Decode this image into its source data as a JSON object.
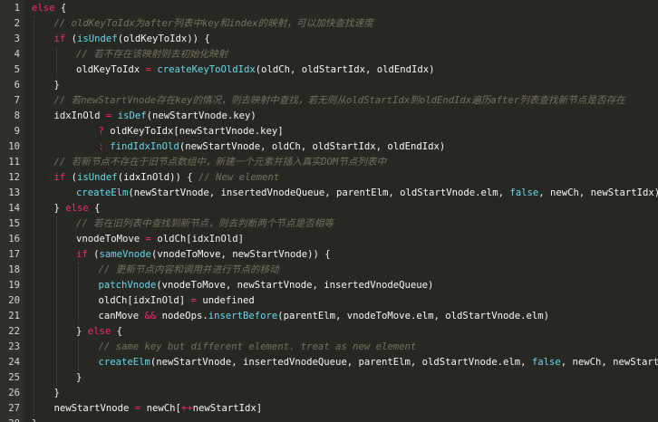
{
  "colors": {
    "background": "#272822",
    "gutter": "#2f302a",
    "plain": "#f8f8f2",
    "keyword": "#f92672",
    "function": "#66d9ef",
    "comment": "#75715e"
  },
  "lines": [
    {
      "n": "1",
      "indent": 0,
      "tokens": [
        {
          "t": "else",
          "c": "kw"
        },
        {
          "t": " {",
          "c": "pl"
        }
      ]
    },
    {
      "n": "2",
      "indent": 1,
      "tokens": [
        {
          "t": "// oldKeyToIdx为after列表中key和index的映射，可以加快查找速度",
          "c": "cm"
        }
      ]
    },
    {
      "n": "3",
      "indent": 1,
      "tokens": [
        {
          "t": "if",
          "c": "kw"
        },
        {
          "t": " (",
          "c": "pl"
        },
        {
          "t": "isUndef",
          "c": "fn"
        },
        {
          "t": "(oldKeyToIdx)) {",
          "c": "pl"
        }
      ]
    },
    {
      "n": "4",
      "indent": 2,
      "tokens": [
        {
          "t": "// 若不存在该映射则去初始化映射",
          "c": "cm"
        }
      ]
    },
    {
      "n": "5",
      "indent": 2,
      "tokens": [
        {
          "t": "oldKeyToIdx ",
          "c": "pl"
        },
        {
          "t": "=",
          "c": "kw"
        },
        {
          "t": " ",
          "c": "pl"
        },
        {
          "t": "createKeyToOldIdx",
          "c": "fn"
        },
        {
          "t": "(oldCh, oldStartIdx, oldEndIdx)",
          "c": "pl"
        }
      ]
    },
    {
      "n": "6",
      "indent": 1,
      "tokens": [
        {
          "t": "}",
          "c": "pl"
        }
      ]
    },
    {
      "n": "7",
      "indent": 1,
      "tokens": [
        {
          "t": "// 若newStartVnode存在key的情况，则去映射中查找，若无则从oldStartIdx到oldEndIdx遍历after列表查找新节点是否存在",
          "c": "cm"
        }
      ]
    },
    {
      "n": "8",
      "indent": 1,
      "tokens": [
        {
          "t": "idxInOld ",
          "c": "pl"
        },
        {
          "t": "=",
          "c": "kw"
        },
        {
          "t": " ",
          "c": "pl"
        },
        {
          "t": "isDef",
          "c": "fn"
        },
        {
          "t": "(newStartVnode.key)",
          "c": "pl"
        }
      ]
    },
    {
      "n": "9",
      "indent": 3,
      "tokens": [
        {
          "t": "?",
          "c": "kw"
        },
        {
          "t": " oldKeyToIdx[newStartVnode.key]",
          "c": "pl"
        }
      ]
    },
    {
      "n": "10",
      "indent": 3,
      "tokens": [
        {
          "t": ":",
          "c": "kw"
        },
        {
          "t": " ",
          "c": "pl"
        },
        {
          "t": "findIdxInOld",
          "c": "fn"
        },
        {
          "t": "(newStartVnode, oldCh, oldStartIdx, oldEndIdx)",
          "c": "pl"
        }
      ]
    },
    {
      "n": "11",
      "indent": 1,
      "tokens": [
        {
          "t": "// 若新节点不存在于旧节点数组中，新建一个元素并插入真实DOM节点列表中",
          "c": "cm"
        }
      ]
    },
    {
      "n": "12",
      "indent": 1,
      "tokens": [
        {
          "t": "if",
          "c": "kw"
        },
        {
          "t": " (",
          "c": "pl"
        },
        {
          "t": "isUndef",
          "c": "fn"
        },
        {
          "t": "(idxInOld)) { ",
          "c": "pl"
        },
        {
          "t": "// New element",
          "c": "cm"
        }
      ]
    },
    {
      "n": "13",
      "indent": 2,
      "tokens": [
        {
          "t": "createElm",
          "c": "fn"
        },
        {
          "t": "(newStartVnode, insertedVnodeQueue, parentElm, oldStartVnode.elm, ",
          "c": "pl"
        },
        {
          "t": "false",
          "c": "con"
        },
        {
          "t": ", newCh, newStartIdx)",
          "c": "pl"
        }
      ]
    },
    {
      "n": "14",
      "indent": 1,
      "tokens": [
        {
          "t": "} ",
          "c": "pl"
        },
        {
          "t": "else",
          "c": "kw"
        },
        {
          "t": " {",
          "c": "pl"
        }
      ]
    },
    {
      "n": "15",
      "indent": 2,
      "tokens": [
        {
          "t": "// 若在旧列表中查找到新节点，则去判断两个节点是否相等",
          "c": "cm"
        }
      ]
    },
    {
      "n": "16",
      "indent": 2,
      "tokens": [
        {
          "t": "vnodeToMove ",
          "c": "pl"
        },
        {
          "t": "=",
          "c": "kw"
        },
        {
          "t": " oldCh[idxInOld]",
          "c": "pl"
        }
      ]
    },
    {
      "n": "17",
      "indent": 2,
      "tokens": [
        {
          "t": "if",
          "c": "kw"
        },
        {
          "t": " (",
          "c": "pl"
        },
        {
          "t": "sameVnode",
          "c": "fn"
        },
        {
          "t": "(vnodeToMove, newStartVnode)) {",
          "c": "pl"
        }
      ]
    },
    {
      "n": "18",
      "indent": 3,
      "tokens": [
        {
          "t": "// 更新节点内容和调用并进行节点的移动",
          "c": "cm"
        }
      ]
    },
    {
      "n": "19",
      "indent": 3,
      "tokens": [
        {
          "t": "patchVnode",
          "c": "fn"
        },
        {
          "t": "(vnodeToMove, newStartVnode, insertedVnodeQueue)",
          "c": "pl"
        }
      ]
    },
    {
      "n": "20",
      "indent": 3,
      "tokens": [
        {
          "t": "oldCh[idxInOld] ",
          "c": "pl"
        },
        {
          "t": "=",
          "c": "kw"
        },
        {
          "t": " undefined",
          "c": "pl"
        }
      ]
    },
    {
      "n": "21",
      "indent": 3,
      "tokens": [
        {
          "t": "canMove ",
          "c": "pl"
        },
        {
          "t": "&&",
          "c": "kw"
        },
        {
          "t": " nodeOps.",
          "c": "pl"
        },
        {
          "t": "insertBefore",
          "c": "fn"
        },
        {
          "t": "(parentElm, vnodeToMove.elm, oldStartVnode.elm)",
          "c": "pl"
        }
      ]
    },
    {
      "n": "22",
      "indent": 2,
      "tokens": [
        {
          "t": "} ",
          "c": "pl"
        },
        {
          "t": "else",
          "c": "kw"
        },
        {
          "t": " {",
          "c": "pl"
        }
      ]
    },
    {
      "n": "23",
      "indent": 3,
      "tokens": [
        {
          "t": "// same key but different element. treat as new element",
          "c": "cm"
        }
      ]
    },
    {
      "n": "24",
      "indent": 3,
      "tokens": [
        {
          "t": "createElm",
          "c": "fn"
        },
        {
          "t": "(newStartVnode, insertedVnodeQueue, parentElm, oldStartVnode.elm, ",
          "c": "pl"
        },
        {
          "t": "false",
          "c": "con"
        },
        {
          "t": ", newCh, newStartIdx)",
          "c": "pl"
        }
      ]
    },
    {
      "n": "25",
      "indent": 2,
      "tokens": [
        {
          "t": "}",
          "c": "pl"
        }
      ]
    },
    {
      "n": "26",
      "indent": 1,
      "tokens": [
        {
          "t": "}",
          "c": "pl"
        }
      ]
    },
    {
      "n": "27",
      "indent": 1,
      "tokens": [
        {
          "t": "newStartVnode ",
          "c": "pl"
        },
        {
          "t": "=",
          "c": "kw"
        },
        {
          "t": " newCh[",
          "c": "pl"
        },
        {
          "t": "++",
          "c": "kw"
        },
        {
          "t": "newStartIdx]",
          "c": "pl"
        }
      ]
    },
    {
      "n": "28",
      "indent": 0,
      "tokens": [
        {
          "t": "}",
          "c": "pl"
        }
      ]
    }
  ]
}
